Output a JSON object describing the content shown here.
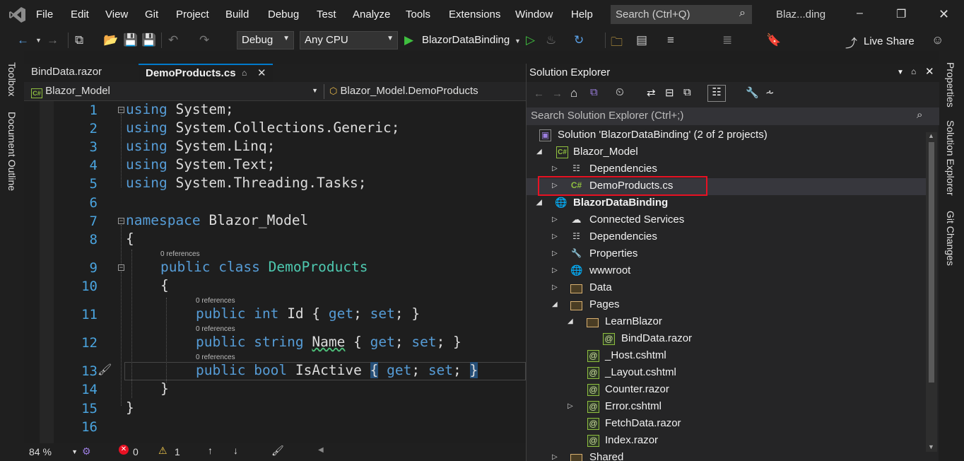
{
  "menu": {
    "items": [
      "File",
      "Edit",
      "View",
      "Git",
      "Project",
      "Build",
      "Debug",
      "Test",
      "Analyze",
      "Tools",
      "Extensions",
      "Window",
      "Help"
    ],
    "search_placeholder": "Search (Ctrl+Q)",
    "window_title": "Blaz...ding"
  },
  "toolbar": {
    "config": "Debug",
    "platform": "Any CPU",
    "run_target": "BlazorDataBinding",
    "live_share": "Live Share"
  },
  "left_rail": {
    "toolbox": "Toolbox",
    "document_outline": "Document Outline"
  },
  "right_rail": {
    "properties": "Properties",
    "solution_explorer": "Solution Explorer",
    "git_changes": "Git Changes"
  },
  "doc_tabs": {
    "tab1": "BindData.razor",
    "tab2": "DemoProducts.cs"
  },
  "nav": {
    "project": "Blazor_Model",
    "type": "Blazor_Model.DemoProducts"
  },
  "editor": {
    "line_numbers": [
      "1",
      "2",
      "3",
      "4",
      "5",
      "6",
      "7",
      "8",
      "9",
      "10",
      "11",
      "12",
      "13",
      "14",
      "15",
      "16"
    ],
    "using_kw": "using",
    "using1": "System;",
    "using2": "System.Collections.Generic;",
    "using3": "System.Linq;",
    "using4": "System.Text;",
    "using5": "System.Threading.Tasks;",
    "namespace_kw": "namespace",
    "namespace_name": "Blazor_Model",
    "open_brace": "{",
    "close_brace": "}",
    "refs": "0 references",
    "public_kw": "public",
    "class_kw": "class",
    "class_name": "DemoProducts",
    "int_kw": "int",
    "string_kw": "string",
    "bool_kw": "bool",
    "prop_id": "Id",
    "prop_name": "Name",
    "prop_isactive": "IsActive",
    "get_kw": "get",
    "set_kw": "set",
    "semicolon": ";"
  },
  "status": {
    "zoom": "84 %",
    "errors": "0",
    "warnings": "1"
  },
  "solution_explorer": {
    "title": "Solution Explorer",
    "search_placeholder": "Search Solution Explorer (Ctrl+;)",
    "nodes": [
      {
        "label": "Solution 'BlazorDataBinding' (2 of 2 projects)"
      },
      {
        "label": "Blazor_Model"
      },
      {
        "label": "Dependencies"
      },
      {
        "label": "DemoProducts.cs"
      },
      {
        "label": "BlazorDataBinding"
      },
      {
        "label": "Connected Services"
      },
      {
        "label": "Dependencies"
      },
      {
        "label": "Properties"
      },
      {
        "label": "wwwroot"
      },
      {
        "label": "Data"
      },
      {
        "label": "Pages"
      },
      {
        "label": "LearnBlazor"
      },
      {
        "label": "BindData.razor"
      },
      {
        "label": "_Host.cshtml"
      },
      {
        "label": "_Layout.cshtml"
      },
      {
        "label": "Counter.razor"
      },
      {
        "label": "Error.cshtml"
      },
      {
        "label": "FetchData.razor"
      },
      {
        "label": "Index.razor"
      },
      {
        "label": "Shared"
      }
    ]
  },
  "colors": {
    "accent": "#007acc",
    "highlight_box": "#e81123",
    "keyword": "#569cd6",
    "type": "#4ec9b0"
  }
}
